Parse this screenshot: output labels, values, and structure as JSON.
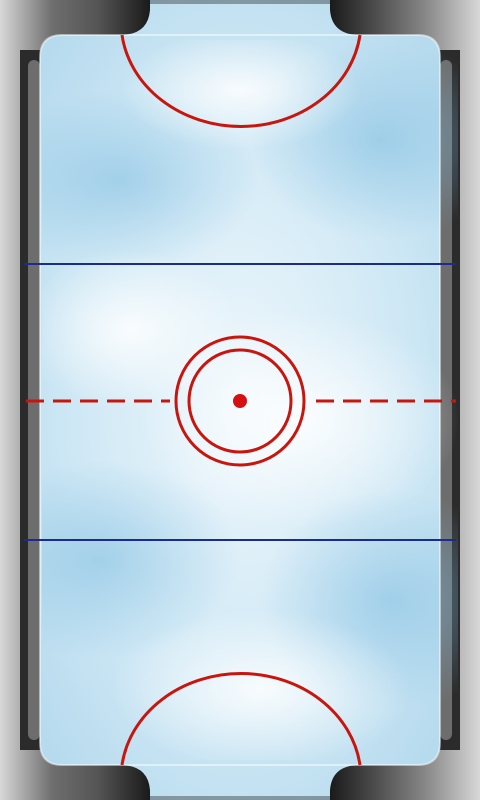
{
  "game": {
    "type": "air-hockey",
    "view": "table-top-down"
  },
  "colors": {
    "frame_dark": "#1a1a1a",
    "frame_mid": "#6e6e6e",
    "frame_light": "#d8d8d8",
    "ice_light": "#e8f4fb",
    "ice_mid": "#b9ddf0",
    "ice_dark": "#8cc4e3",
    "red_line": "#c8160f",
    "blue_line": "#1b2c8a",
    "center_dot": "#d41010"
  }
}
